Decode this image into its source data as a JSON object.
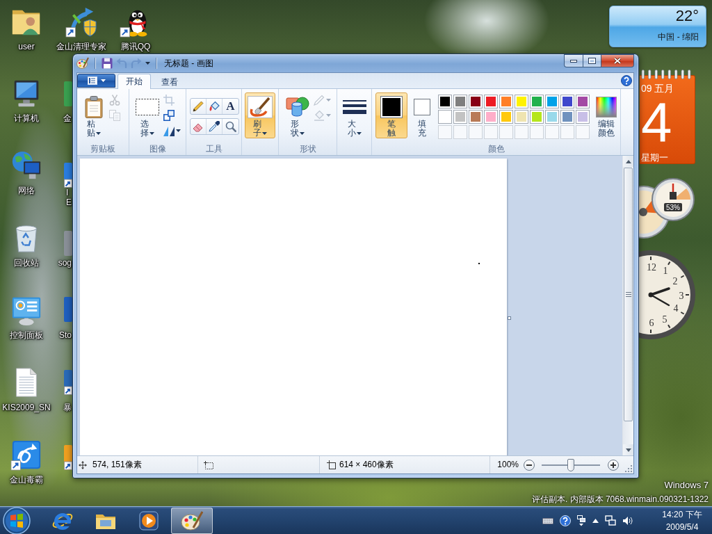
{
  "desktop_icons": [
    {
      "label": "user",
      "shortcut": false
    },
    {
      "label": "金山清理专家",
      "shortcut": true
    },
    {
      "label": "腾讯QQ",
      "shortcut": true
    },
    {
      "label": "计算机",
      "shortcut": false
    },
    {
      "label": "网络",
      "shortcut": false
    },
    {
      "label": "回收站",
      "shortcut": false
    },
    {
      "label": "控制面板",
      "shortcut": false
    },
    {
      "label": "KIS2009_SN",
      "shortcut": false
    },
    {
      "label": "金山毒霸",
      "shortcut": true
    }
  ],
  "partly_hidden_icons": [
    {
      "label": "金",
      "shortcut": false
    },
    {
      "label": "I E",
      "shortcut": true
    },
    {
      "label": "sog",
      "shortcut": false
    },
    {
      "label": "Sto",
      "shortcut": false
    },
    {
      "label": "暴",
      "shortcut": true
    },
    {
      "shortcut": true
    }
  ],
  "gadgets": {
    "weather": {
      "temperature": "22°",
      "location": "中国 - 绵阳"
    },
    "calendar": {
      "month": "09 五月",
      "day": "4",
      "weekday": "星期一"
    },
    "meter": {
      "reading": "53%"
    },
    "clock": {
      "numerals": [
        "12",
        "1",
        "2",
        "3",
        "4",
        "5",
        "6"
      ]
    }
  },
  "window": {
    "title": "无标题 - 画图",
    "quick_access": {
      "save": {
        "disabled": false
      },
      "undo": {
        "disabled": true
      },
      "redo": {
        "disabled": true
      }
    },
    "tabs": [
      {
        "label": "开始",
        "selected": true
      },
      {
        "label": "查看",
        "selected": false
      }
    ],
    "clipboard": {
      "label": "剪贴板",
      "paste": "粘贴",
      "cut": {
        "disabled": true
      },
      "copy": {
        "disabled": true
      }
    },
    "image": {
      "label": "图像",
      "select": "选择",
      "crop": {
        "disabled": true
      },
      "resize": {
        "disabled": false
      },
      "rotate": {
        "disabled": false
      }
    },
    "tools": {
      "label": "工具",
      "items": [
        {
          "selected": false
        },
        {
          "selected": false
        },
        {
          "symbol": "A",
          "selected": false
        },
        {
          "selected": false
        },
        {
          "selected": false
        },
        {
          "selected": false
        }
      ]
    },
    "brushes": {
      "label": "刷子",
      "selected": true
    },
    "shapes": {
      "label": "形状",
      "button": "形状",
      "outline": {
        "disabled": true
      },
      "fill": {
        "disabled": true
      }
    },
    "size": {
      "label": "大小"
    },
    "colors": {
      "label": "颜色",
      "color1": {
        "label": "笔触",
        "color": "#000000",
        "selected": true
      },
      "color2": {
        "label": "填充",
        "color": "#ffffff",
        "selected": false
      },
      "palette": [
        {
          "kind": "swatch",
          "color": "#000000"
        },
        {
          "kind": "swatch",
          "color": "#7f7f7f"
        },
        {
          "kind": "swatch",
          "color": "#880015"
        },
        {
          "kind": "swatch",
          "color": "#ed1c24"
        },
        {
          "kind": "swatch",
          "color": "#ff7f27"
        },
        {
          "kind": "swatch",
          "color": "#fff200"
        },
        {
          "kind": "swatch",
          "color": "#22b14c"
        },
        {
          "kind": "swatch",
          "color": "#00a2e8"
        },
        {
          "kind": "swatch",
          "color": "#3f48cc"
        },
        {
          "kind": "swatch",
          "color": "#a349a4"
        },
        {
          "kind": "swatch",
          "color": "#ffffff"
        },
        {
          "kind": "swatch",
          "color": "#c3c3c3"
        },
        {
          "kind": "swatch",
          "color": "#b97a57"
        },
        {
          "kind": "swatch",
          "color": "#ffaec9"
        },
        {
          "kind": "swatch",
          "color": "#ffc90e"
        },
        {
          "kind": "swatch",
          "color": "#efe4b0"
        },
        {
          "kind": "swatch",
          "color": "#b5e61d"
        },
        {
          "kind": "swatch",
          "color": "#99d9ea"
        },
        {
          "kind": "swatch",
          "color": "#7092be"
        },
        {
          "kind": "swatch",
          "color": "#c8bfe7"
        },
        {
          "kind": "empty"
        },
        {
          "kind": "empty"
        },
        {
          "kind": "empty"
        },
        {
          "kind": "empty"
        },
        {
          "kind": "empty"
        },
        {
          "kind": "empty"
        },
        {
          "kind": "empty"
        },
        {
          "kind": "empty"
        },
        {
          "kind": "empty"
        },
        {
          "kind": "empty"
        }
      ],
      "edit": "编辑颜色"
    },
    "status_bar": {
      "position": "574, 151像素",
      "canvas_size": "614 × 460像素",
      "zoom": "100%",
      "zoom_slider": {
        "level": 0.5
      }
    }
  },
  "os_notice": {
    "edition": "Windows 7",
    "build": "评估副本. 内部版本 7068.winmain.090321-1322"
  },
  "taskbar": {
    "buttons": [
      {
        "selected": false
      },
      {
        "selected": false
      },
      {
        "selected": false
      },
      {
        "selected": true
      }
    ],
    "tray": {
      "time": "14:20 下午",
      "date": "2009/5/4"
    }
  }
}
